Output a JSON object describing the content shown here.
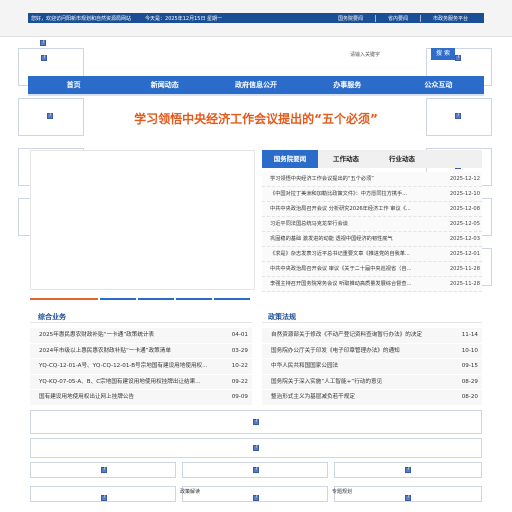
{
  "topbar": {
    "welcome": "您好，欢迎访问阳新市规划和自然资源局网站",
    "today": "今天是：2025年12月15日 星期一",
    "links": [
      "国务院要闻",
      "省内要闻",
      "市政务服务平台"
    ]
  },
  "search": {
    "placeholder": "请输入关键字",
    "button_label": "搜 索"
  },
  "nav": {
    "items": [
      "首页",
      "新闻动态",
      "政府信息公开",
      "办事服务",
      "公众互动"
    ]
  },
  "headline": "学习领悟中央经济工作会议提出的“五个必须”",
  "news": {
    "tabs": [
      "国务院要闻",
      "工作动态",
      "行业动态"
    ],
    "active_tab": "国务院要闻",
    "items": [
      {
        "title": "学习领悟中央经济工作会议提出的“五个必须”",
        "date": "2025-12-12"
      },
      {
        "title": "《中国对拉丁美洲和加勒比政策文件》：中方愿同拉方携手...",
        "date": "2025-12-10"
      },
      {
        "title": "中共中央政治局召开会议 分析研究2026年经济工作 审议《...",
        "date": "2025-12-08"
      },
      {
        "title": "习近平同法国总统马克龙举行会谈",
        "date": "2025-12-05"
      },
      {
        "title": "巩固稳的基础 激发进的动能 透视中国经济的韧性底气",
        "date": "2025-12-03"
      },
      {
        "title": "《求是》杂志发表习近平总书记重要文章《推进党的自我革...",
        "date": "2025-12-01"
      },
      {
        "title": "中共中央政治局召开会议 审议《关于二十届中央巡视省（自...",
        "date": "2025-11-28"
      },
      {
        "title": "李强主持召开国务院常务会议 听取推动高质量发展综合督查...",
        "date": "2025-11-28"
      }
    ]
  },
  "sections": {
    "left": {
      "title": "综合业务",
      "items": [
        {
          "title": "2025年惠民惠农财政补贴“一卡通”政策统计表",
          "date": "04-01"
        },
        {
          "title": "2024年市级以上惠民惠农财政补贴“一卡通”政策清单",
          "date": "03-29"
        },
        {
          "title": "YQ-CQ-12-01-A号、YQ-CQ-12-01-B号宗地国有建设用地使用权...",
          "date": "10-22"
        },
        {
          "title": "YQ-KQ-07-05-A、B、C宗地国有建设用地使用权挂牌出让结果...",
          "date": "09-22"
        },
        {
          "title": "国有建设用地使用权出让网上挂牌公告",
          "date": "09-09"
        }
      ]
    },
    "right": {
      "title": "政策法规",
      "items": [
        {
          "title": "自然资源部关于修改《不动产登记资料查询暂行办法》的决定",
          "date": "11-14"
        },
        {
          "title": "国务院办公厅关于印发《电子印章管理办法》的通知",
          "date": "10-10"
        },
        {
          "title": "中华人民共和国国家公园法",
          "date": "09-15"
        },
        {
          "title": "国务院关于深入实施“人工智能+”行动的意见",
          "date": "08-29"
        },
        {
          "title": "整治形式主义为基层减负若干规定",
          "date": "08-20"
        }
      ]
    }
  },
  "bottom": {
    "labels": [
      "政策解读",
      "专题规划"
    ]
  },
  "colors": {
    "primary": "#2b6bc9",
    "topbar": "#1a4f96",
    "headline": "#e45a1c",
    "section_title": "#1b4d9a",
    "accent_bar": "#e4652a"
  },
  "icons": [
    "broken-image-icon"
  ]
}
